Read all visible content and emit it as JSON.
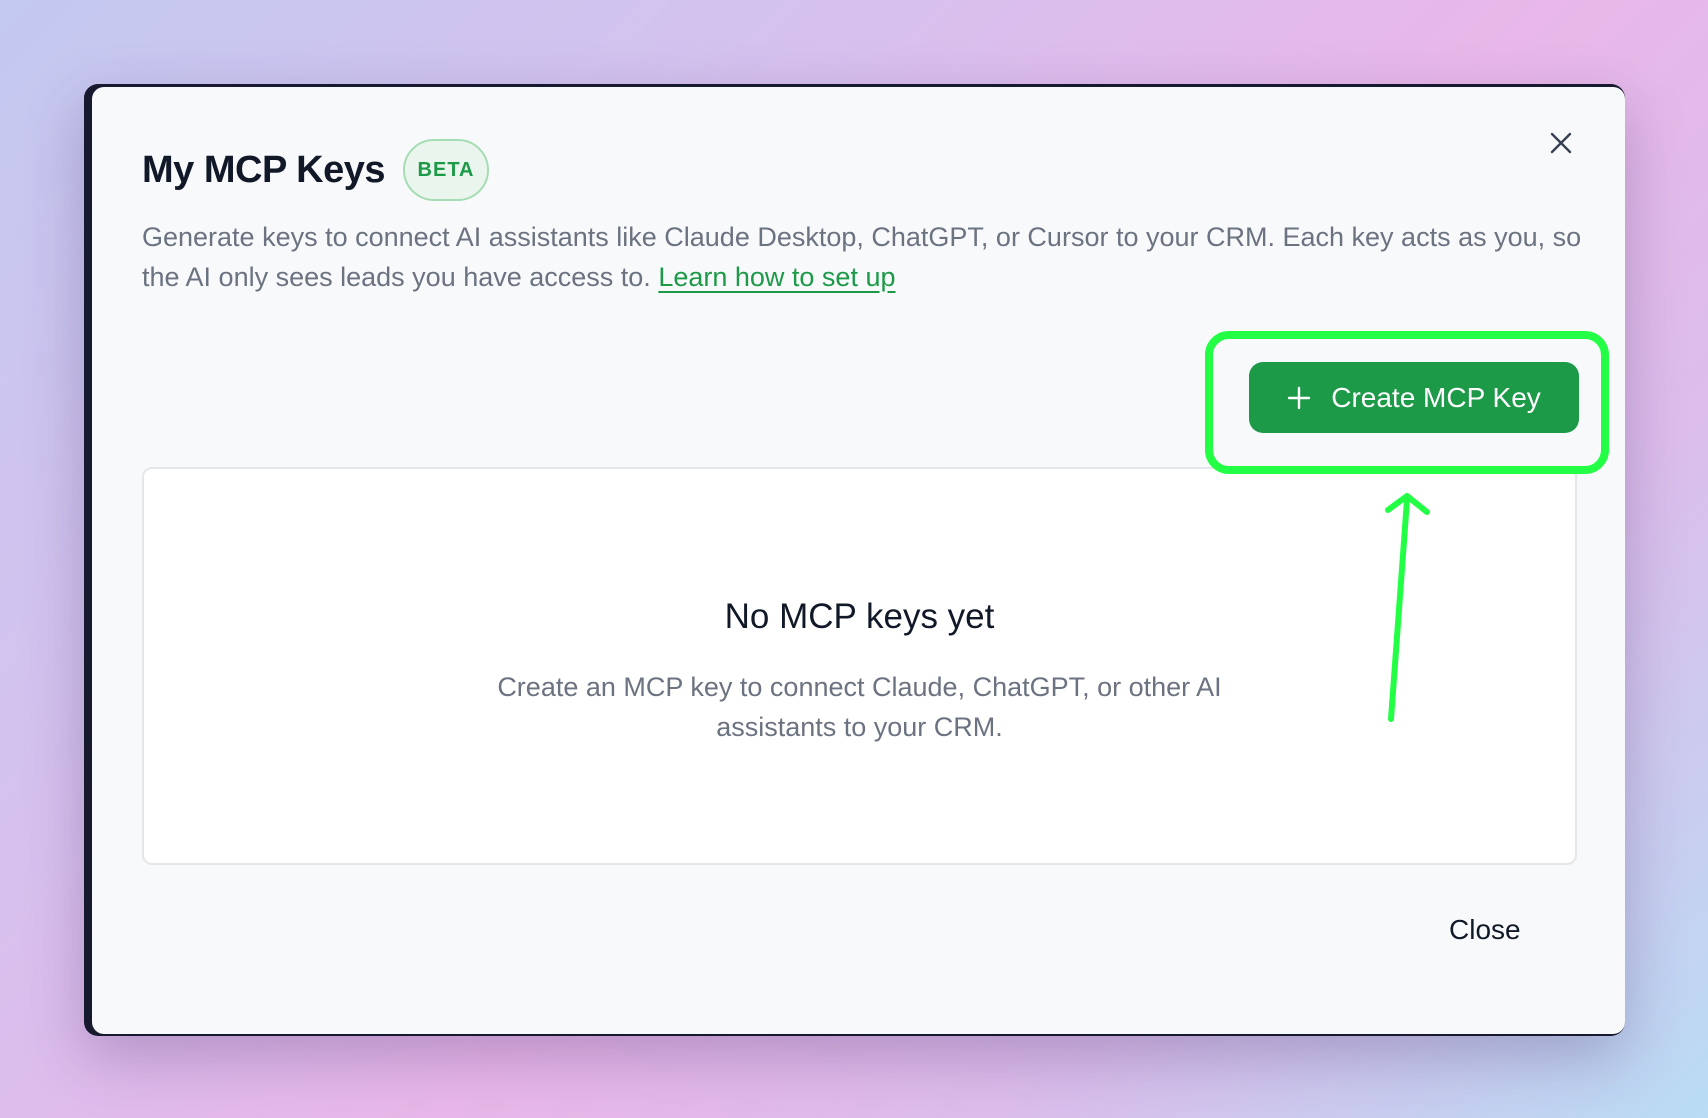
{
  "modal": {
    "title": "My MCP Keys",
    "badge": "BETA",
    "description": "Generate keys to connect AI assistants like Claude Desktop, ChatGPT, or Cursor to your CRM. Each key acts as you, so the AI only sees leads you have access to.",
    "learn_link": "Learn how to set up",
    "create_button_label": "Create MCP Key",
    "empty_state": {
      "title": "No MCP keys yet",
      "text": "Create an MCP key to connect Claude, ChatGPT, or other AI assistants to your CRM."
    },
    "close_label": "Close"
  },
  "colors": {
    "accent": "#1c9a48",
    "annotation": "#22ff44",
    "badge_bg": "#eaf6ed"
  },
  "icons": {
    "close": "close-icon",
    "plus": "plus-icon",
    "annotation": "highlight-arrow"
  }
}
